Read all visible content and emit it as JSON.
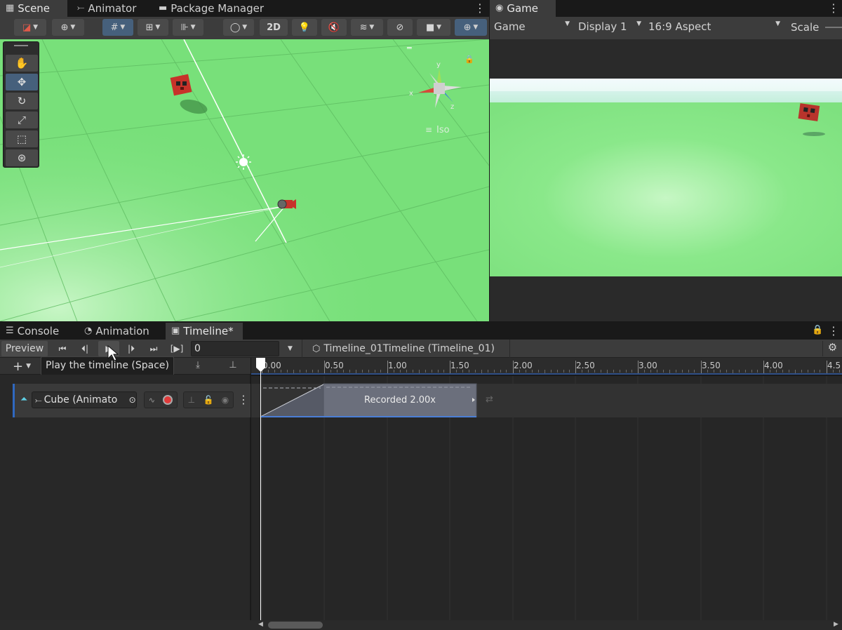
{
  "top_tabs": {
    "scene": "Scene",
    "animator": "Animator",
    "package_manager": "Package Manager",
    "game": "Game"
  },
  "scene_toolbar": {
    "two_d": "2D",
    "iso": "Iso",
    "gizmo_axes": {
      "x": "x",
      "y": "y",
      "z": "z"
    }
  },
  "game_toolbar": {
    "display_mode": "Game",
    "display": "Display 1",
    "aspect": "16:9 Aspect",
    "scale": "Scale"
  },
  "bottom_tabs": {
    "console": "Console",
    "animation": "Animation",
    "timeline": "Timeline*"
  },
  "timeline_toolbar": {
    "preview": "Preview",
    "frame_value": "0",
    "asset": "Timeline_01Timeline (Timeline_01)"
  },
  "tooltip": "Play the timeline (Space)",
  "track": {
    "name": "Cube (Animato",
    "clip_label": "Recorded 2.00x"
  },
  "ruler": [
    "0.00",
    "0.50",
    "1.00",
    "1.50",
    "2.00",
    "2.50",
    "3.00",
    "3.50",
    "4.00",
    "4.5"
  ],
  "colors": {
    "accent": "#46607c",
    "scene_ground": "#78e07a",
    "clip": "#6b6f7c",
    "track_accent": "#2f68c0",
    "record": "#e03a3a"
  }
}
